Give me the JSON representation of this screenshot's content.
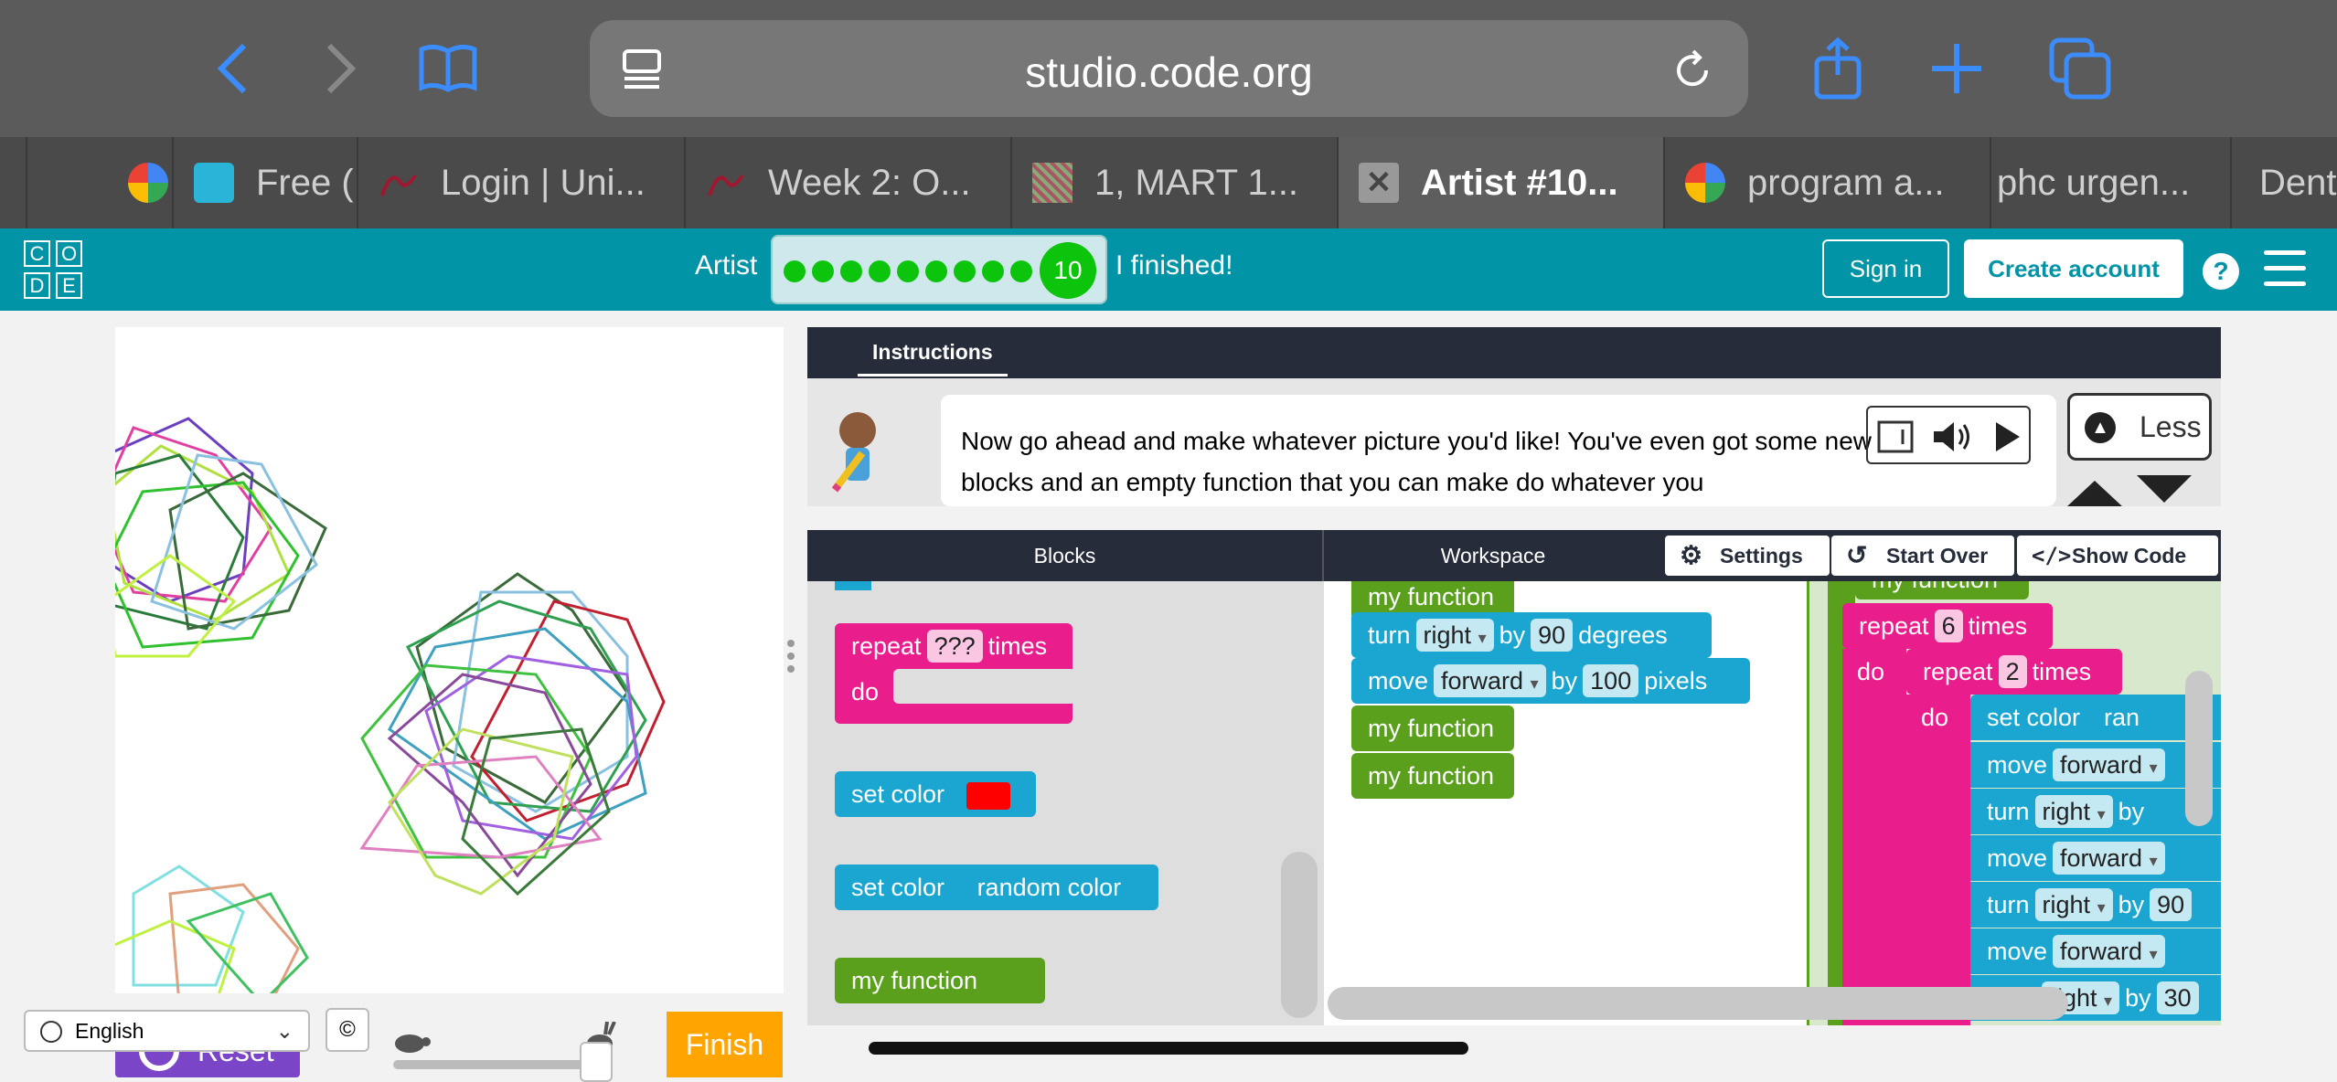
{
  "browser": {
    "url": "studio.code.org",
    "tabs": [
      {
        "label": "",
        "active": false
      },
      {
        "label": "Free (",
        "active": false
      },
      {
        "label": "Login | Uni...",
        "active": false
      },
      {
        "label": "Week 2: O...",
        "active": false
      },
      {
        "label": "1, MART 1...",
        "active": false
      },
      {
        "label": "Artist #10...",
        "active": true
      },
      {
        "label": "program a...",
        "active": false
      },
      {
        "label": "phc urgen...",
        "active": false
      },
      {
        "label": "Denta",
        "active": false
      }
    ]
  },
  "header": {
    "logo_letters": [
      "C",
      "O",
      "D",
      "E"
    ],
    "level_title": "Artist",
    "current_level": "10",
    "finished_link": "I finished!",
    "sign_in": "Sign in",
    "create_account": "Create account",
    "help": "?"
  },
  "instructions": {
    "tab_label": "Instructions",
    "text": "Now go ahead and make whatever picture you'd like! You've even got some new blocks and an empty function that you can make do whatever you",
    "less_label": "Less"
  },
  "editor": {
    "blocks_header": "Blocks",
    "workspace_header": "Workspace",
    "settings_label": "Settings",
    "start_over_label": "Start Over",
    "show_code_label": "Show Code"
  },
  "toolbox": {
    "repeat_label": "repeat",
    "repeat_value": "???",
    "times_label": "times",
    "do_label": "do",
    "set_color_label": "set color",
    "random_color_label": "random color",
    "my_function_label": "my function",
    "swatch_color": "#ff0000"
  },
  "workspace": {
    "my_function": "my function",
    "turn": "turn",
    "right": "right",
    "by": "by",
    "degrees": "degrees",
    "turn_value": "90",
    "move": "move",
    "forward": "forward",
    "move_value": "100",
    "pixels": "pixels",
    "repeat": "repeat",
    "times": "times",
    "do": "do",
    "outer_repeat_value": "6",
    "inner_repeat_value": "2",
    "set_color": "set color",
    "set_color_partial": "ran",
    "partial_by": "by",
    "partial_num_90": "90",
    "partial_num_30": "30"
  },
  "footer": {
    "language": "English",
    "copyright": "©",
    "reset": "Reset",
    "finish": "Finish"
  },
  "colors": {
    "codeorg_teal": "#0094a6",
    "progress_green": "#0cc40c",
    "finish_orange": "#ffa400",
    "reset_purple": "#7b45c7",
    "loop_pink": "#e91e8c",
    "draw_blue": "#1aa6d0",
    "function_green": "#5aa01c"
  }
}
